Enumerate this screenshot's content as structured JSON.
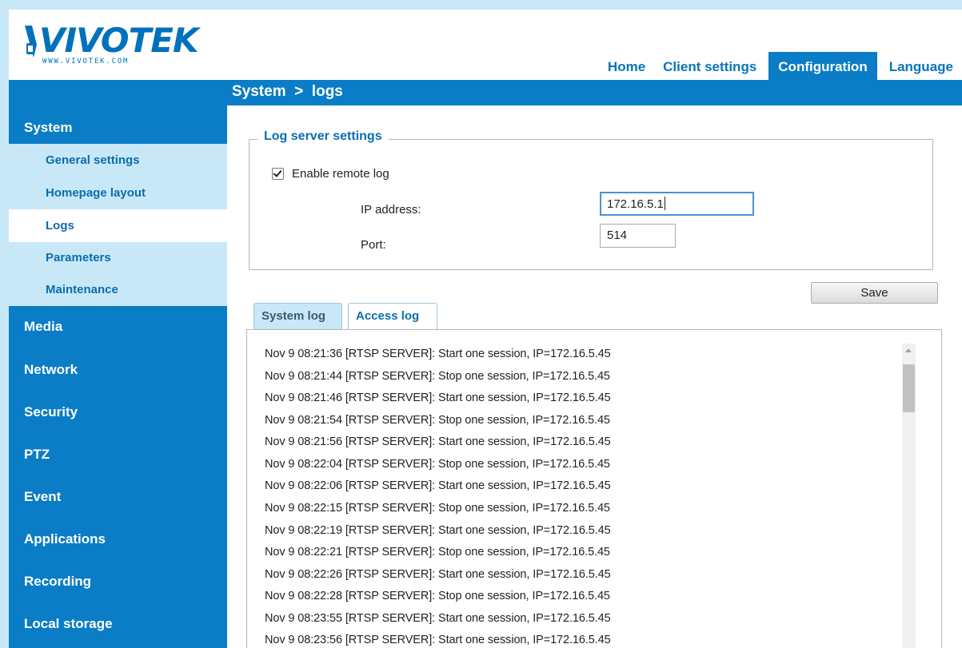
{
  "brand": {
    "name": "VIVOTEK",
    "url": "WWW.VIVOTEK.COM"
  },
  "topnav": [
    {
      "label": "Home",
      "active": false
    },
    {
      "label": "Client settings",
      "active": false
    },
    {
      "label": "Configuration",
      "active": true
    },
    {
      "label": "Language",
      "active": false
    }
  ],
  "breadcrumb": "System  >  logs",
  "sidebar": {
    "system": "System",
    "subitems": [
      {
        "label": "General settings"
      },
      {
        "label": "Homepage layout"
      },
      {
        "label": "Logs",
        "active": true
      },
      {
        "label": "Parameters"
      },
      {
        "label": "Maintenance"
      }
    ],
    "categories": [
      "Media",
      "Network",
      "Security",
      "PTZ",
      "Event",
      "Applications",
      "Recording",
      "Local storage"
    ]
  },
  "log_server": {
    "legend": "Log server settings",
    "enable_label": "Enable remote log",
    "enable_checked": true,
    "ip_label": "IP address:",
    "ip_value": "172.16.5.1",
    "port_label": "Port:",
    "port_value": "514"
  },
  "save_label": "Save",
  "log_tabs": [
    {
      "label": "System log",
      "active": true
    },
    {
      "label": "Access log",
      "active": false
    }
  ],
  "log_lines": [
    "Nov 9 08:21:36 [RTSP SERVER]: Start one session, IP=172.16.5.45",
    "Nov 9 08:21:44 [RTSP SERVER]: Stop one session, IP=172.16.5.45",
    "Nov 9 08:21:46 [RTSP SERVER]: Start one session, IP=172.16.5.45",
    "Nov 9 08:21:54 [RTSP SERVER]: Stop one session, IP=172.16.5.45",
    "Nov 9 08:21:56 [RTSP SERVER]: Start one session, IP=172.16.5.45",
    "Nov 9 08:22:04 [RTSP SERVER]: Stop one session, IP=172.16.5.45",
    "Nov 9 08:22:06 [RTSP SERVER]: Start one session, IP=172.16.5.45",
    "Nov 9 08:22:15 [RTSP SERVER]: Stop one session, IP=172.16.5.45",
    "Nov 9 08:22:19 [RTSP SERVER]: Start one session, IP=172.16.5.45",
    "Nov 9 08:22:21 [RTSP SERVER]: Stop one session, IP=172.16.5.45",
    "Nov 9 08:22:26 [RTSP SERVER]: Start one session, IP=172.16.5.45",
    "Nov 9 08:22:28 [RTSP SERVER]: Stop one session, IP=172.16.5.45",
    "Nov 9 08:23:55 [RTSP SERVER]: Start one session, IP=172.16.5.45",
    "Nov 9 08:23:56 [RTSP SERVER]: Start one session, IP=172.16.5.45"
  ],
  "colors": {
    "primary_blue": "#0a7dc6",
    "light_blue": "#c9e8f7",
    "link_blue": "#0a6eb0"
  }
}
